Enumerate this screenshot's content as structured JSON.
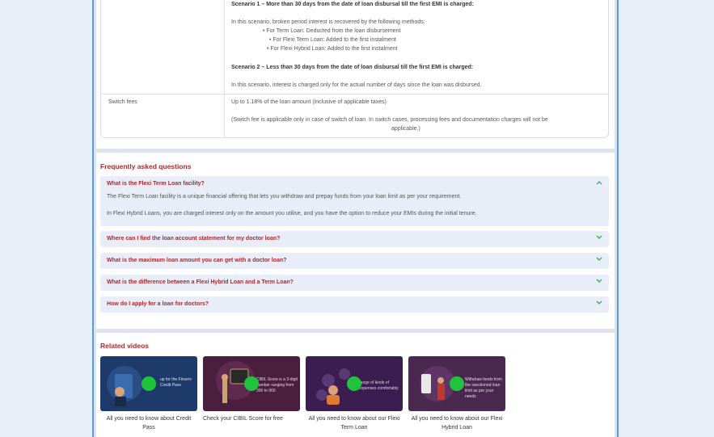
{
  "charges": {
    "scenario1_title": "Scenario 1 – More than 30 days from the date of loan disbursal till the first EMI is charged:",
    "scenario1_intro": "In this scenario, broken period interest is recovered by the following methods:",
    "scenario1_points": [
      "• For Term Loan: Deducted from the loan disbursement",
      "• For Flexi Term Loan: Added to the first instalment",
      "• For Flexi Hybrid Loan: Added to the first instalment"
    ],
    "scenario2_title": "Scenario 2 – Less than 30 days from the date of loan disbursal till the first EMI is charged:",
    "scenario2_text": "In this scenario, interest is charged only for the actual number of days since the loan was disbursed.",
    "switch_label": "Switch fees",
    "switch_value": "Up to 1.18% of the loan amount (inclusive of applicable taxes)",
    "switch_note_1": "(Switch fee is applicable only in case of switch of loan. In switch cases, processing fees and documentation charges will not be",
    "switch_note_2": "applicable.)"
  },
  "faq": {
    "heading": "Frequently asked questions",
    "open_question": "What is the Flexi Term Loan facility?",
    "open_answer_1": "The Flexi Term Loan facility is a unique financial offering that lets you withdraw and prepay funds from your loan limit as per your requirement.",
    "open_answer_2": "In Flexi Hybrid Loans, you are charged interest only on the amount you utilise, and you have the option to reduce your EMIs during the initial tenure.",
    "questions": [
      "Where can I find the loan account statement for my doctor loan?",
      "What is the maximum loan amount you can get with a doctor loan?",
      "What is the difference between a Flexi Hybrid Loan and a Term Loan?",
      "How do I apply for a loan for doctors?"
    ]
  },
  "videos": {
    "heading": "Related videos",
    "items": [
      {
        "title": "All you need to know about Credit Pass",
        "thumb_text": "up for the Finserv Credit Pass"
      },
      {
        "title": "Check your CIBIL Score for free",
        "thumb_text": "CIBIL Score is a 3-digit number ranging from 300 to 900"
      },
      {
        "title": "All you need to know about our Flexi Term Loan",
        "thumb_text": "range of kinds of expenses comfortably"
      },
      {
        "title": "All you need to know about our Flexi Hybrid Loan",
        "thumb_text": "Withdraw funds from the sanctioned loan limit as per your needs"
      }
    ]
  },
  "colors": {
    "accent": "#b3272d",
    "play": "#1fc43c",
    "faq_bg": "#e8edf7",
    "chevron": "#2bb34a"
  }
}
